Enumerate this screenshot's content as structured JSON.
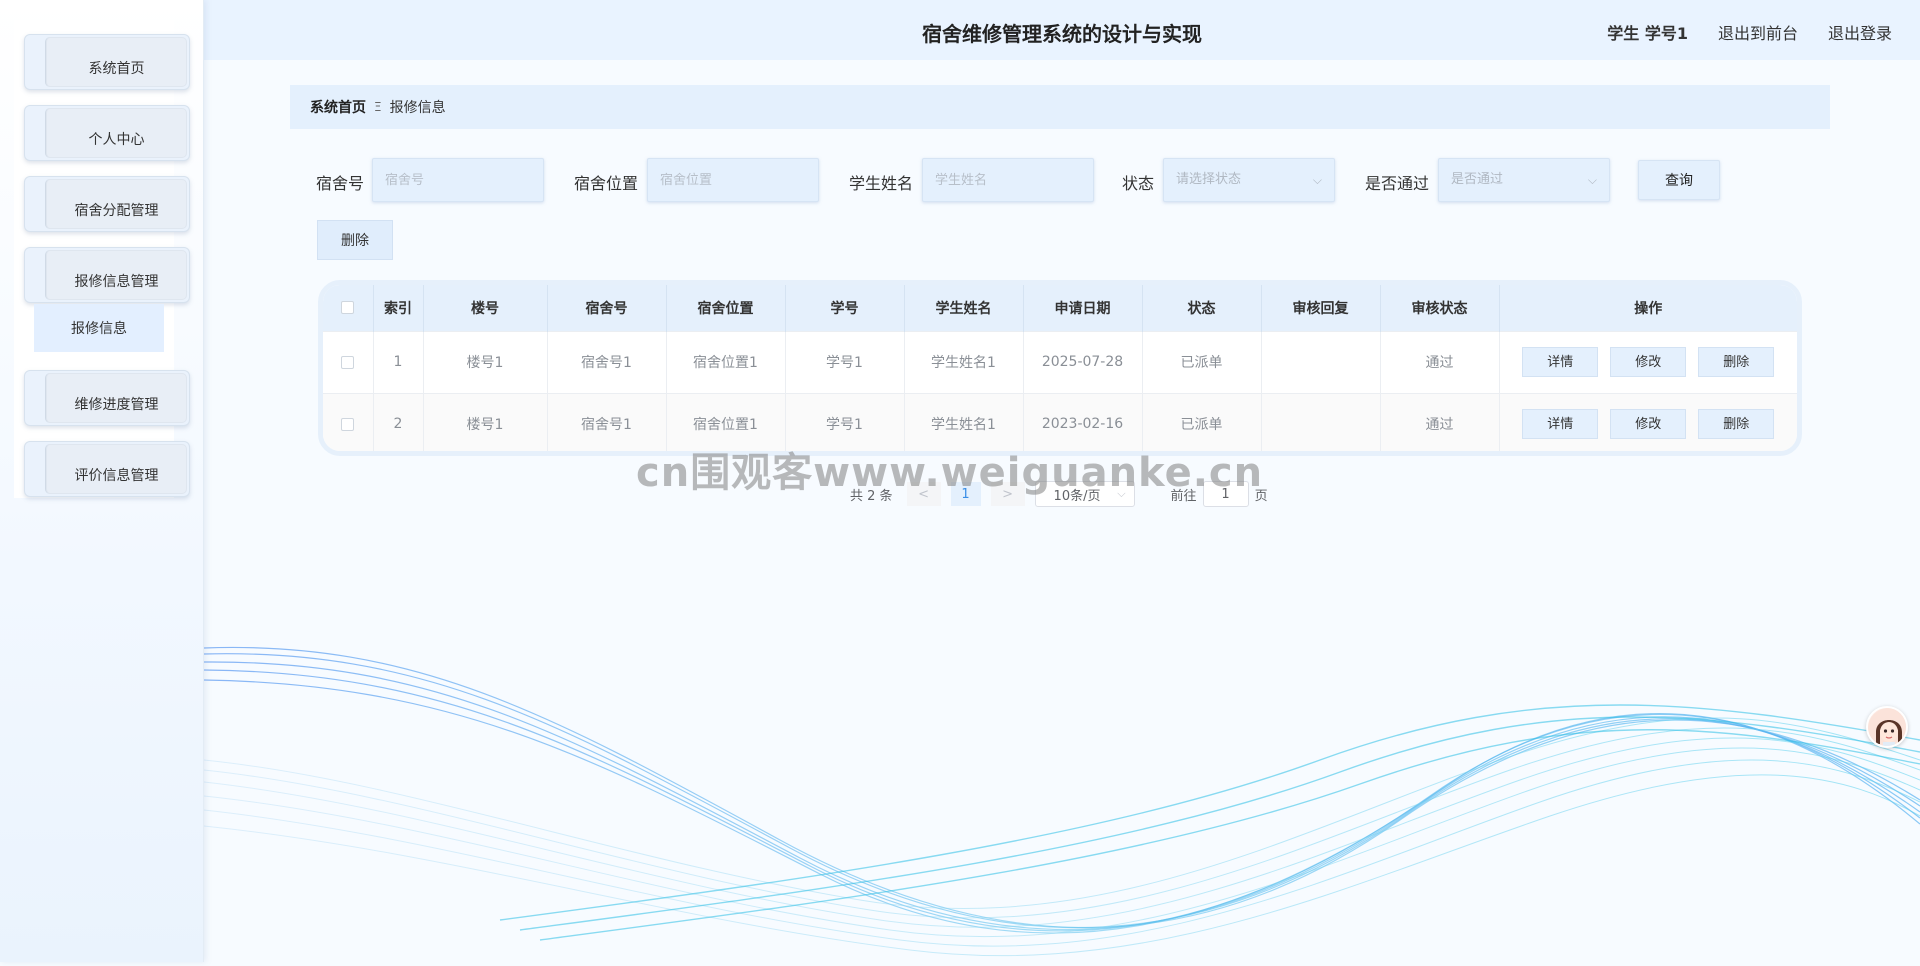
{
  "header": {
    "title": "宿舍维修管理系统的设计与实现",
    "user": "学生 学号1",
    "to_front": "退出到前台",
    "logout": "退出登录"
  },
  "sidebar": {
    "items": [
      {
        "label": "系统首页"
      },
      {
        "label": "个人中心"
      },
      {
        "label": "宿舍分配管理"
      },
      {
        "label": "报修信息管理"
      },
      {
        "label": "维修进度管理"
      },
      {
        "label": "评价信息管理"
      }
    ],
    "submenu": {
      "label": "报修信息"
    }
  },
  "breadcrumb": {
    "home": "系统首页",
    "separator": "Ξ",
    "current": "报修信息"
  },
  "search": {
    "dorm_no_label": "宿舍号",
    "dorm_no_placeholder": "宿舍号",
    "dorm_loc_label": "宿舍位置",
    "dorm_loc_placeholder": "宿舍位置",
    "student_name_label": "学生姓名",
    "student_name_placeholder": "学生姓名",
    "status_label": "状态",
    "status_placeholder": "请选择状态",
    "passed_label": "是否通过",
    "passed_placeholder": "是否通过",
    "query_button": "查询"
  },
  "actions": {
    "delete_button": "删除"
  },
  "table": {
    "headers": [
      "索引",
      "楼号",
      "宿舍号",
      "宿舍位置",
      "学号",
      "学生姓名",
      "申请日期",
      "状态",
      "审核回复",
      "审核状态",
      "操作"
    ],
    "rows": [
      {
        "index": "1",
        "building": "楼号1",
        "dorm_no": "宿舍号1",
        "dorm_loc": "宿舍位置1",
        "student_no": "学号1",
        "student_name": "学生姓名1",
        "date": "2025-07-28",
        "status": "已派单",
        "reply": "",
        "review_status": "通过"
      },
      {
        "index": "2",
        "building": "楼号1",
        "dorm_no": "宿舍号1",
        "dorm_loc": "宿舍位置1",
        "student_no": "学号1",
        "student_name": "学生姓名1",
        "date": "2023-02-16",
        "status": "已派单",
        "reply": "",
        "review_status": "通过"
      }
    ],
    "op_detail": "详情",
    "op_edit": "修改",
    "op_delete": "删除"
  },
  "pagination": {
    "total": "共 2 条",
    "prev": "<",
    "current_page": "1",
    "next": ">",
    "page_size": "10条/页",
    "goto_prefix": "前往",
    "goto_value": "1",
    "goto_suffix": "页"
  },
  "watermark": "cn围观客www.weiguanke.cn",
  "colors": {
    "accent": "#e4f0fd",
    "header_bg": "#e9f3ff",
    "wave_blue": "#3d8ee8",
    "wave_cyan": "#35c6e8"
  }
}
